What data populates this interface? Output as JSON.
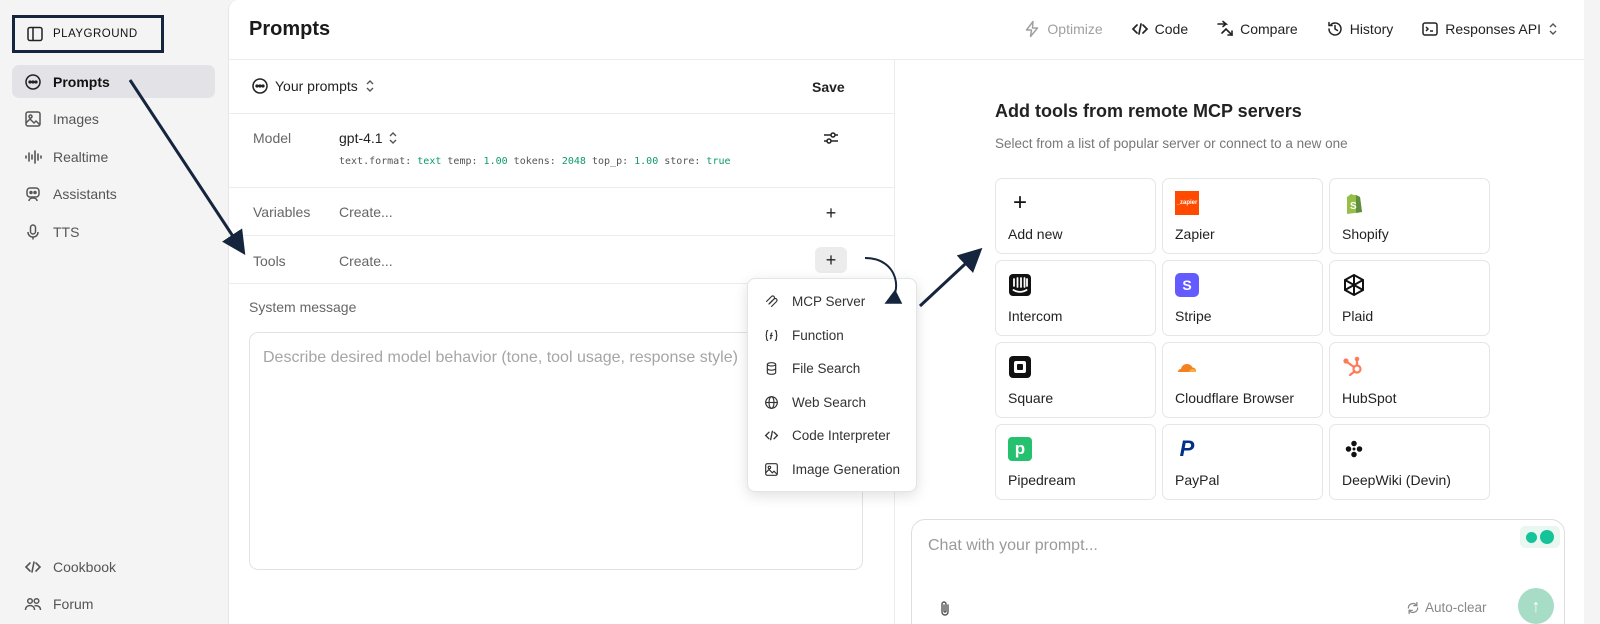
{
  "app": {
    "brand": "PLAYGROUND"
  },
  "sidebar": {
    "items": [
      {
        "label": "Prompts",
        "icon": "chat-bubble-icon",
        "active": true
      },
      {
        "label": "Images",
        "icon": "image-icon"
      },
      {
        "label": "Realtime",
        "icon": "waveform-icon"
      },
      {
        "label": "Assistants",
        "icon": "robot-icon"
      },
      {
        "label": "TTS",
        "icon": "microphone-icon"
      }
    ],
    "bottom": [
      {
        "label": "Cookbook",
        "icon": "code-icon"
      },
      {
        "label": "Forum",
        "icon": "people-icon"
      }
    ]
  },
  "header": {
    "title": "Prompts",
    "actions": {
      "optimize": "Optimize",
      "code": "Code",
      "compare": "Compare",
      "history": "History",
      "api": "Responses API"
    }
  },
  "prompt": {
    "selector": "Your prompts",
    "save": "Save",
    "model_label": "Model",
    "model": "gpt-4.1",
    "params": {
      "format_key": "text.format:",
      "format_val": "text",
      "temp_key": "temp:",
      "temp_val": "1.00",
      "tokens_key": "tokens:",
      "tokens_val": "2048",
      "top_p_key": "top_p:",
      "top_p_val": "1.00",
      "store_key": "store:",
      "store_val": "true"
    },
    "variables_label": "Variables",
    "variables_value": "Create...",
    "tools_label": "Tools",
    "tools_value": "Create...",
    "system_label": "System message",
    "system_placeholder": "Describe desired model behavior (tone, tool usage, response style)"
  },
  "tools_menu": [
    {
      "label": "MCP Server",
      "icon": "mcp-icon"
    },
    {
      "label": "Function",
      "icon": "function-icon"
    },
    {
      "label": "File Search",
      "icon": "database-icon"
    },
    {
      "label": "Web Search",
      "icon": "globe-icon"
    },
    {
      "label": "Code Interpreter",
      "icon": "code-icon"
    },
    {
      "label": "Image Generation",
      "icon": "image-icon"
    }
  ],
  "mcp": {
    "title": "Add tools from remote MCP servers",
    "subtitle": "Select from a list of popular server or connect to a new one",
    "servers": [
      {
        "label": "Add new",
        "icon": "plus-icon"
      },
      {
        "label": "Zapier",
        "icon": "zapier-logo",
        "logo_text": "_zapier"
      },
      {
        "label": "Shopify",
        "icon": "shopify-logo"
      },
      {
        "label": "Intercom",
        "icon": "intercom-logo"
      },
      {
        "label": "Stripe",
        "icon": "stripe-logo",
        "logo_text": "S"
      },
      {
        "label": "Plaid",
        "icon": "plaid-logo"
      },
      {
        "label": "Square",
        "icon": "square-logo"
      },
      {
        "label": "Cloudflare Browser",
        "icon": "cloudflare-logo"
      },
      {
        "label": "HubSpot",
        "icon": "hubspot-logo"
      },
      {
        "label": "Pipedream",
        "icon": "pipedream-logo",
        "logo_text": "p"
      },
      {
        "label": "PayPal",
        "icon": "paypal-logo",
        "logo_text": "P"
      },
      {
        "label": "DeepWiki (Devin)",
        "icon": "deepwiki-logo"
      }
    ]
  },
  "chat": {
    "placeholder": "Chat with your prompt...",
    "auto_clear": "Auto-clear"
  },
  "colors": {
    "accent_green": "#0f9a6e",
    "arrow": "#14253d",
    "send_button": "#a7dcc6"
  }
}
